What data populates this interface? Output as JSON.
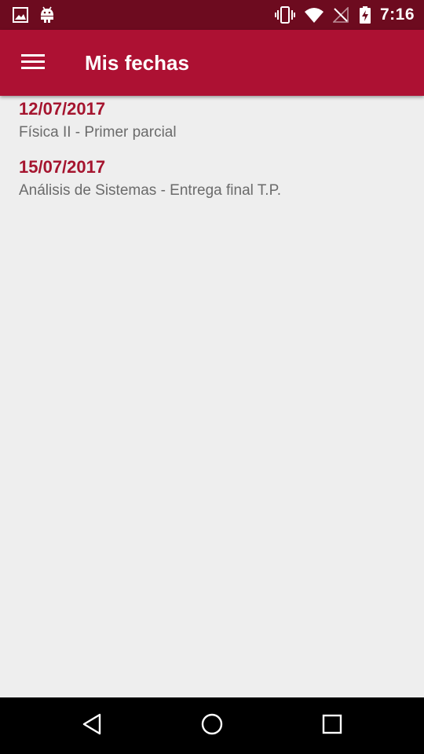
{
  "status_bar": {
    "time": "7:16",
    "icons": [
      "image-icon",
      "android-icon",
      "vibrate-icon",
      "wifi-icon",
      "no-signal-icon",
      "battery-charging-icon"
    ]
  },
  "app_bar": {
    "title": "Mis fechas",
    "menu_icon": "hamburger-menu-icon"
  },
  "dates": [
    {
      "date": "12/07/2017",
      "description": "Física II - Primer parcial"
    },
    {
      "date": "15/07/2017",
      "description": "Análisis de Sistemas - Entrega final T.P."
    }
  ],
  "nav_bar": {
    "icons": [
      "back-icon",
      "home-icon",
      "recents-icon"
    ]
  },
  "colors": {
    "status_bar": "#6d0b1f",
    "app_bar": "#ad1133",
    "accent": "#a5152f",
    "background": "#eeeeee"
  }
}
